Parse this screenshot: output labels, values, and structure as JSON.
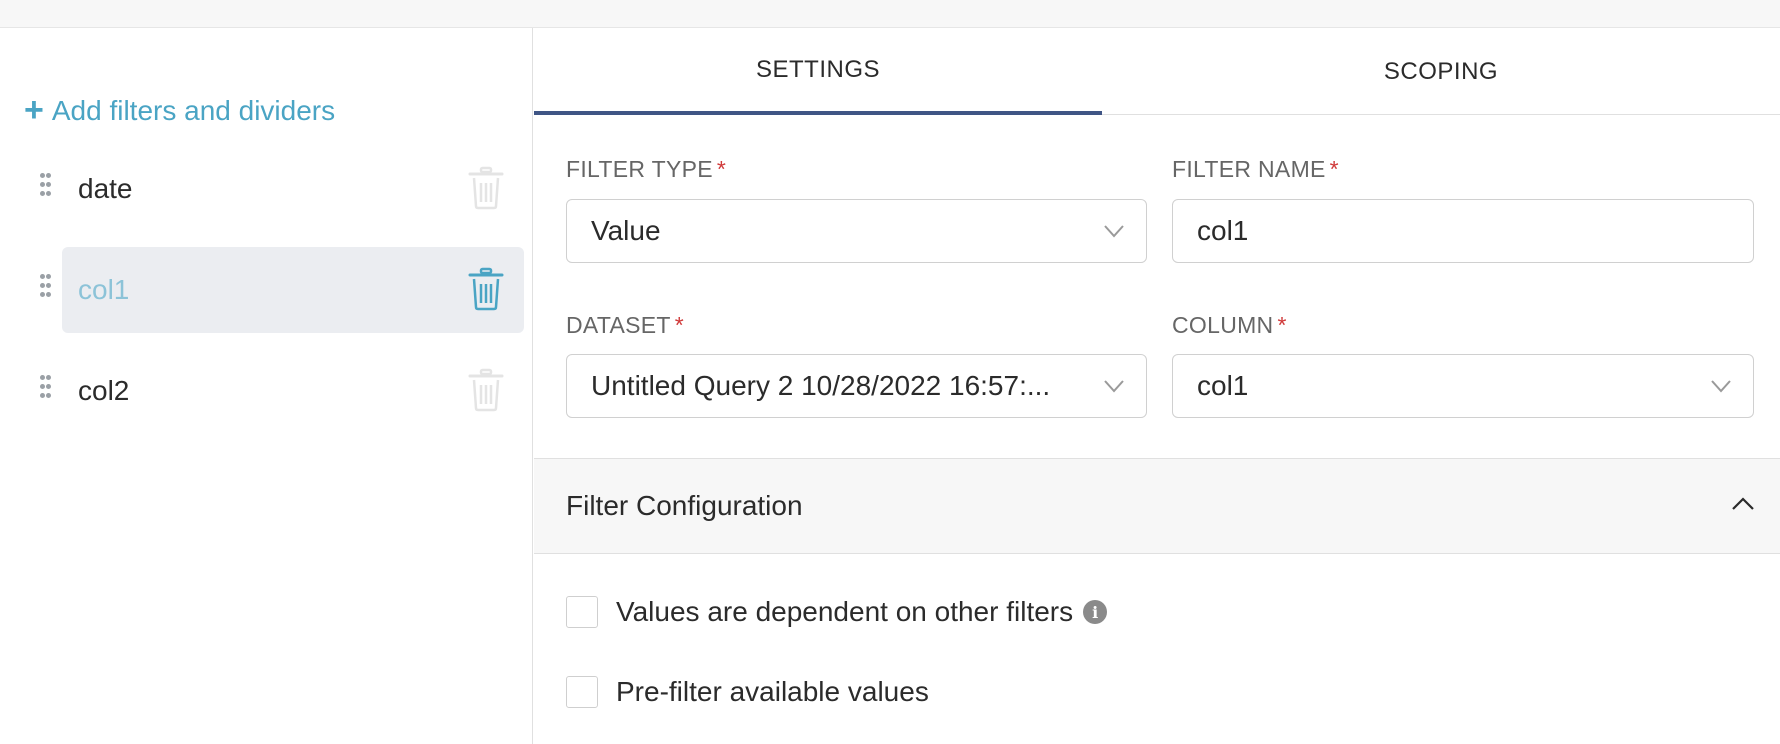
{
  "sidebar": {
    "add_link": "Add filters and dividers",
    "items": [
      {
        "label": "date"
      },
      {
        "label": "col1"
      },
      {
        "label": "col2"
      }
    ]
  },
  "tabs": {
    "settings": "SETTINGS",
    "scoping": "SCOPING"
  },
  "form": {
    "filter_type": {
      "label": "FILTER TYPE",
      "value": "Value"
    },
    "filter_name": {
      "label": "FILTER NAME",
      "value": "col1"
    },
    "dataset": {
      "label": "DATASET",
      "value": "Untitled Query 2 10/28/2022 16:57:..."
    },
    "column": {
      "label": "COLUMN",
      "value": "col1"
    },
    "required_mark": "*"
  },
  "section": {
    "title": "Filter Configuration"
  },
  "options": {
    "dependent": "Values are dependent on other filters",
    "prefilter": "Pre-filter available values"
  },
  "colors": {
    "accent": "#4aa4c4",
    "tab_active": "#3f5585",
    "required": "#d03a3a",
    "selected_bg": "#ebedf1"
  },
  "icons": {
    "plus": "plus-icon",
    "drag": "drag-handle-icon",
    "trash": "trash-icon",
    "chevron_down": "chevron-down-icon",
    "chevron_up": "chevron-up-icon",
    "info": "info-icon"
  }
}
